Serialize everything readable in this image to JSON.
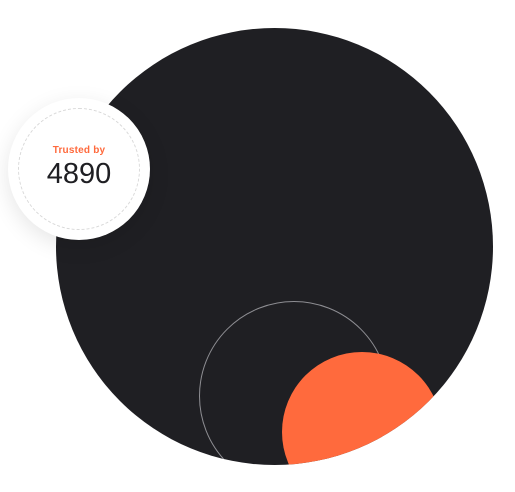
{
  "badge": {
    "label": "Trusted by",
    "count": "4890"
  },
  "colors": {
    "dark": "#1f1f23",
    "accent": "#ff6a3d",
    "ring": "#8e8e93",
    "background": "#ffffff"
  }
}
